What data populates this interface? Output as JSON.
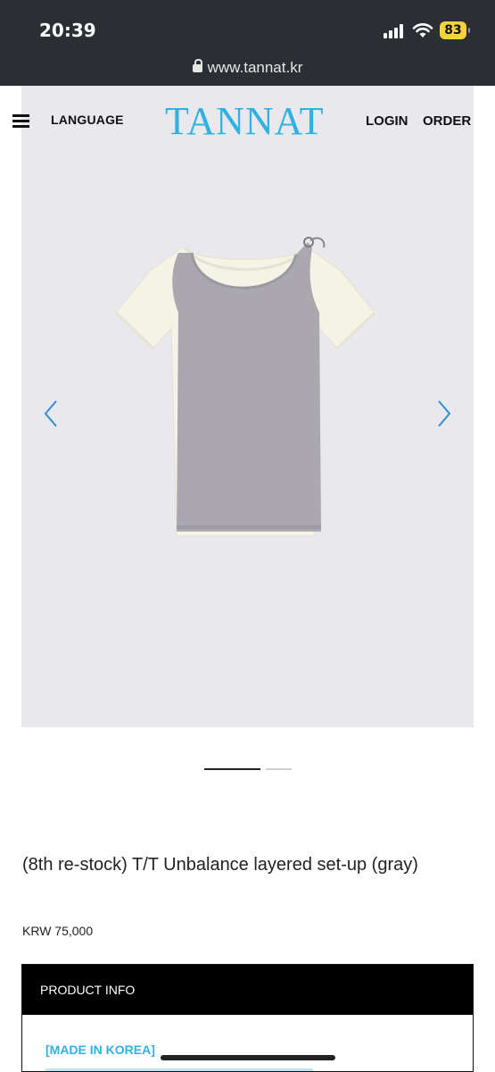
{
  "status_bar": {
    "time": "20:39",
    "battery": "83",
    "url": "www.tannat.kr"
  },
  "header": {
    "language": "LANGUAGE",
    "logo": "TANNAT",
    "login": "LOGIN",
    "order": "ORDER"
  },
  "carousel": {
    "current_slide": 1,
    "total_slides": 2,
    "prev_icon": "chevron-left-icon",
    "next_icon": "chevron-right-icon"
  },
  "product": {
    "title": "(8th re-stock) T/T Unbalance layered set-up (gray)",
    "price": "KRW 75,000"
  },
  "product_info": {
    "heading": "PRODUCT INFO",
    "origin": "[MADE IN KOREA]"
  },
  "colors": {
    "accent": "#2fb1e1",
    "background": "#ffffff",
    "photo_background": "#e9e8ec"
  }
}
